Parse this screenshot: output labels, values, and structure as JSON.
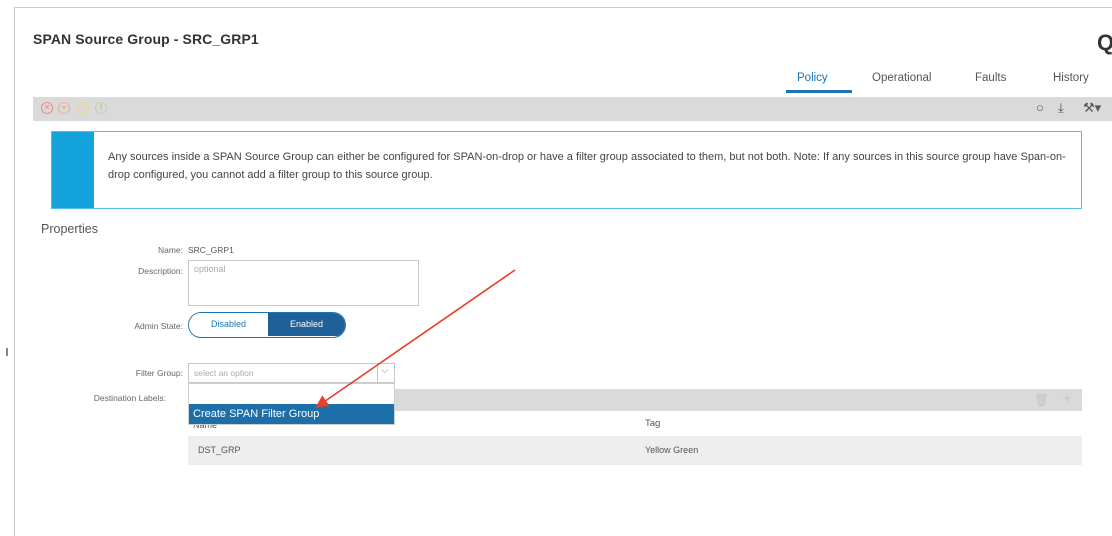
{
  "title": "SPAN Source Group - SRC_GRP1",
  "corner_glyph": "Q",
  "tabs": [
    {
      "label": "Policy",
      "active": true
    },
    {
      "label": "Operational",
      "active": false
    },
    {
      "label": "Faults",
      "active": false
    },
    {
      "label": "History",
      "active": false
    }
  ],
  "toolbar": {
    "fault_icons": [
      "critical-fault-icon",
      "major-fault-icon",
      "minor-fault-icon",
      "warning-fault-icon"
    ],
    "right_icons": [
      "refresh-icon",
      "download-icon",
      "tools-icon"
    ]
  },
  "banner": {
    "text": "Any sources inside a SPAN Source Group can either be configured for SPAN-on-drop or have a filter group associated to them, but not both. Note: If any sources in this source group have Span-on-drop configured, you cannot add a filter group to this source group."
  },
  "properties": {
    "heading": "Properties",
    "name_label": "Name:",
    "name_value": "SRC_GRP1",
    "description_label": "Description:",
    "description_placeholder": "optional",
    "admin_state_label": "Admin State:",
    "admin_state_options": [
      "Disabled",
      "Enabled"
    ],
    "admin_state_selected": "Enabled",
    "filter_group_label": "Filter Group:",
    "filter_group_placeholder": "select an option",
    "filter_group_dropdown_item": "Create SPAN Filter Group",
    "destination_labels_label": "Destination Labels:"
  },
  "table": {
    "columns": [
      "Name",
      "Tag"
    ],
    "rows": [
      {
        "name": "DST_GRP",
        "tag": "Yellow Green"
      }
    ]
  },
  "colors": {
    "accent": "#1f74b5",
    "banner_bar": "#14a3dc",
    "annotation_arrow": "#e8402b"
  }
}
